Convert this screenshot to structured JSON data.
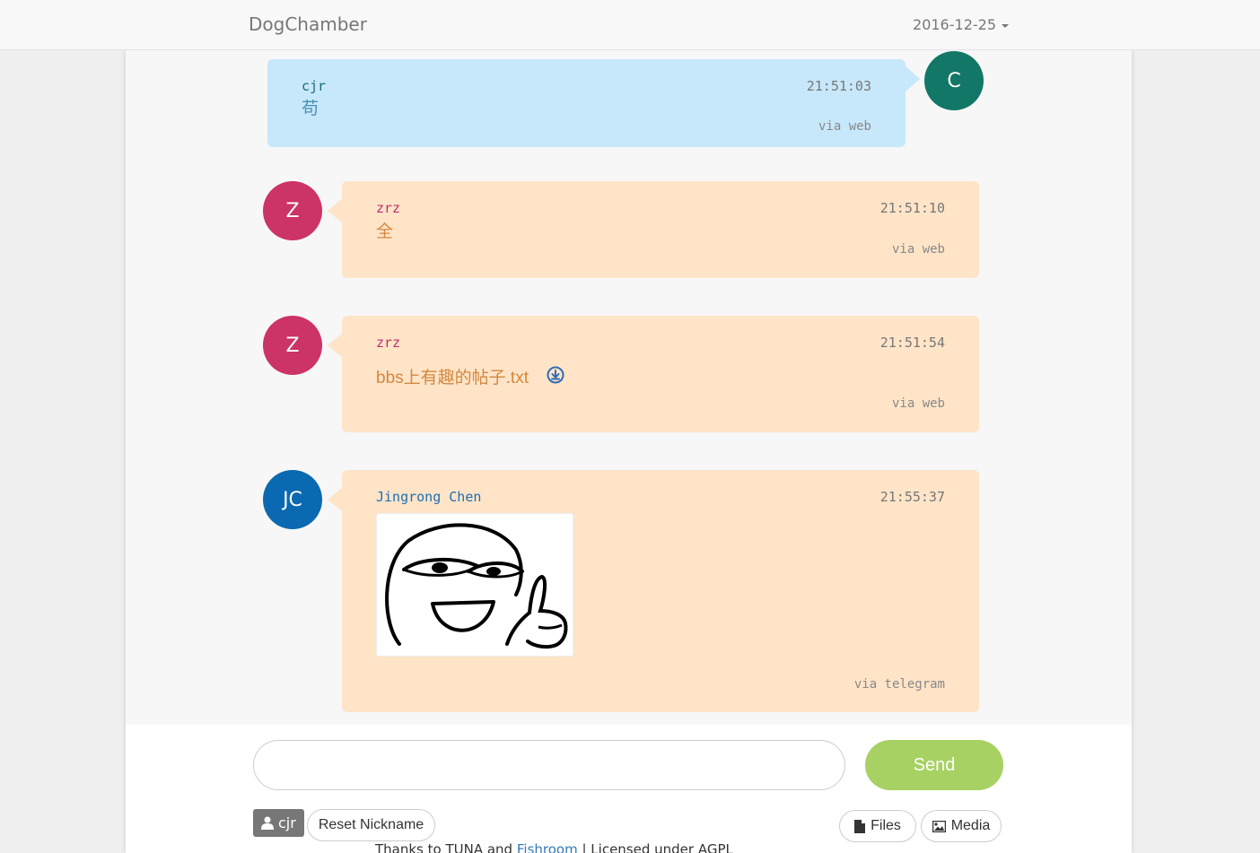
{
  "navbar": {
    "brand": "DogChamber",
    "date": "2016-12-25"
  },
  "messages": [
    {
      "nick": "cjr",
      "time": "21:51:03",
      "text": "苟",
      "via": "via web",
      "avatar": "C",
      "self": true
    },
    {
      "nick": "zrz",
      "time": "21:51:10",
      "text": "全",
      "via": "via web",
      "avatar": "Z"
    },
    {
      "nick": "zrz",
      "time": "21:51:54",
      "file": "bbs上有趣的帖子.txt",
      "via": "via web",
      "avatar": "Z"
    },
    {
      "nick": "Jingrong Chen",
      "time": "21:55:37",
      "image": "troll-face-thumbs-up-sticker",
      "via": "via telegram",
      "avatar": "JC"
    }
  ],
  "composer": {
    "input_value": "",
    "send_label": "Send"
  },
  "toolbar": {
    "nickname": "cjr",
    "reset_label": "Reset Nickname",
    "files_label": "Files",
    "media_label": "Media"
  },
  "footer": {
    "prefix": "Thanks to TUNA and ",
    "link": "Fishroom",
    "suffix": " | Licensed under AGPL"
  },
  "colors": {
    "self_bubble": "#c7e8fb",
    "other_bubble": "#ffe4c8",
    "avatar_c": "#137767",
    "avatar_z": "#cc3366",
    "avatar_jc": "#0a69b0",
    "nick_self": "#1a6b6b",
    "nick_zrz": "#c0306e",
    "nick_jc": "#1a6fb5",
    "text_self": "#4a8fb5",
    "text_other": "#d2883f",
    "send_button": "#a7d163"
  }
}
